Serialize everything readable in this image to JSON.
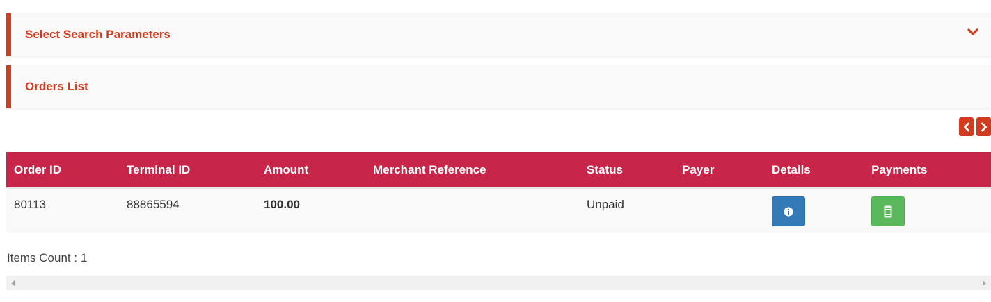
{
  "search_panel": {
    "title": "Select Search Parameters"
  },
  "orders_panel": {
    "title": "Orders List"
  },
  "colors": {
    "accent": "#d03c1d",
    "table_header": "#c8254a",
    "details_button": "#337ab7",
    "payments_button": "#5cb85c"
  },
  "table": {
    "columns": [
      "Order ID",
      "Terminal ID",
      "Amount",
      "Merchant Reference",
      "Status",
      "Payer",
      "Details",
      "Payments"
    ],
    "rows": [
      {
        "order_id": "80113",
        "terminal_id": "88865594",
        "amount": "100.00",
        "merchant_reference": "",
        "status": "Unpaid",
        "payer": ""
      }
    ]
  },
  "footer": {
    "items_count": "Items Count : 1"
  },
  "icons": {
    "collapse": "chevron-down-icon",
    "prev": "chevron-left-icon",
    "next": "chevron-right-icon",
    "details": "info-icon",
    "payments": "receipt-icon"
  }
}
